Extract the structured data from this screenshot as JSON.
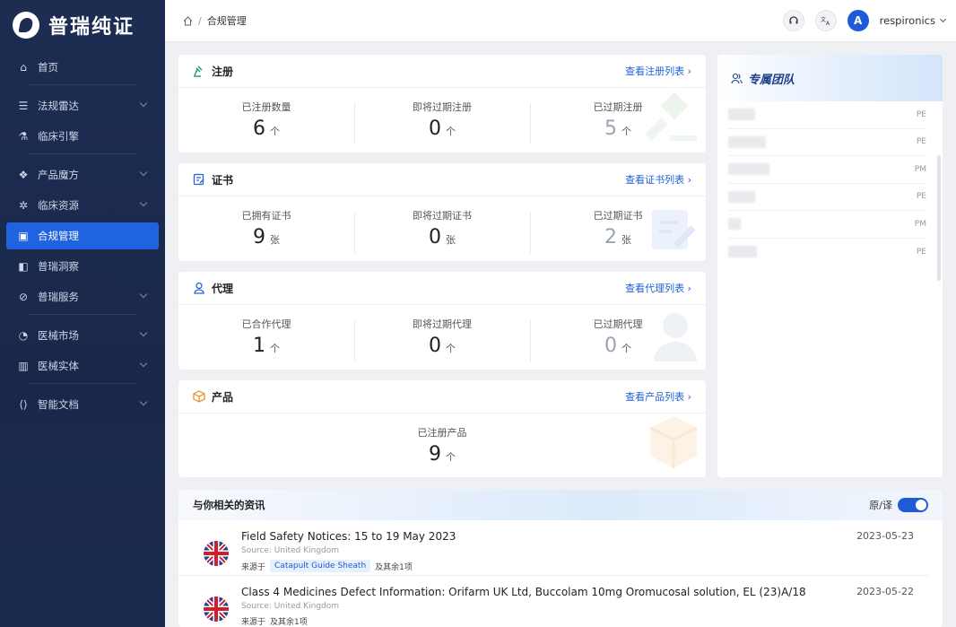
{
  "brand": {
    "name": "普瑞纯证"
  },
  "sidebar": {
    "items": [
      {
        "label": "首页",
        "icon": "home-icon",
        "glyph": "⌂",
        "chevron": false,
        "active": false
      },
      {
        "label": "法规雷达",
        "icon": "radar-icon",
        "glyph": "☰",
        "chevron": true,
        "active": false
      },
      {
        "label": "临床引擎",
        "icon": "flask-icon",
        "glyph": "⚗",
        "chevron": false,
        "active": false
      },
      {
        "label": "产品魔方",
        "icon": "cube-icon",
        "glyph": "❖",
        "chevron": true,
        "active": false
      },
      {
        "label": "临床资源",
        "icon": "resource-icon",
        "glyph": "✲",
        "chevron": true,
        "active": false
      },
      {
        "label": "合规管理",
        "icon": "compliance-icon",
        "glyph": "▣",
        "chevron": false,
        "active": true
      },
      {
        "label": "普瑞洞察",
        "icon": "insight-icon",
        "glyph": "◧",
        "chevron": false,
        "active": false
      },
      {
        "label": "普瑞服务",
        "icon": "service-icon",
        "glyph": "⊘",
        "chevron": true,
        "active": false
      },
      {
        "label": "医械市场",
        "icon": "market-icon",
        "glyph": "◔",
        "chevron": true,
        "active": false
      },
      {
        "label": "医械实体",
        "icon": "entity-icon",
        "glyph": "▥",
        "chevron": true,
        "active": false
      },
      {
        "label": "智能文档",
        "icon": "document-icon",
        "glyph": "⟨⟩",
        "chevron": true,
        "active": false
      }
    ]
  },
  "header": {
    "breadcrumb": "合规管理",
    "user": {
      "initial": "A",
      "name": "respironics"
    },
    "icons": [
      "headset-icon",
      "translate-icon"
    ]
  },
  "cards": {
    "registration": {
      "title": "注册",
      "link": "查看注册列表 ›",
      "stats": [
        {
          "label": "已注册数量",
          "value": "6",
          "unit": "个"
        },
        {
          "label": "即将过期注册",
          "value": "0",
          "unit": "个"
        },
        {
          "label": "已过期注册",
          "value": "5",
          "unit": "个"
        }
      ]
    },
    "certificate": {
      "title": "证书",
      "link": "查看证书列表 ›",
      "stats": [
        {
          "label": "已拥有证书",
          "value": "9",
          "unit": "张"
        },
        {
          "label": "即将过期证书",
          "value": "0",
          "unit": "张"
        },
        {
          "label": "已过期证书",
          "value": "2",
          "unit": "张"
        }
      ]
    },
    "agent": {
      "title": "代理",
      "link": "查看代理列表 ›",
      "stats": [
        {
          "label": "已合作代理",
          "value": "1",
          "unit": "个"
        },
        {
          "label": "即将过期代理",
          "value": "0",
          "unit": "个"
        },
        {
          "label": "已过期代理",
          "value": "0",
          "unit": "个"
        }
      ]
    },
    "product": {
      "title": "产品",
      "link": "查看产品列表 ›",
      "stats": [
        {
          "label": "已注册产品",
          "value": "9",
          "unit": "个"
        }
      ]
    }
  },
  "team": {
    "title": "专属团队",
    "members": [
      {
        "role": "PE"
      },
      {
        "role": "PE"
      },
      {
        "role": "PM"
      },
      {
        "role": "PE"
      },
      {
        "role": "PM"
      },
      {
        "role": "PE"
      }
    ]
  },
  "news": {
    "title": "与你相关的资讯",
    "toggle_label": "原/译",
    "items": [
      {
        "headline": "Field Safety Notices: 15 to 19 May 2023",
        "source": "Source: United Kingdom",
        "from_label": "来源于",
        "tag": "Catapult Guide Sheath",
        "more": "及其余1项",
        "date": "2023-05-23"
      },
      {
        "headline": "Class 4 Medicines Defect Information: Orifarm UK Ltd, Buccolam 10mg Oromucosal solution, EL (23)A/18",
        "source": "Source: United Kingdom",
        "from_label": "来源于",
        "tag": "",
        "more": "及其余1项",
        "date": "2023-05-22"
      }
    ]
  },
  "colors": {
    "sidebar_bg": "#1d2d52",
    "accent": "#1f63e0",
    "link": "#2263d8"
  }
}
